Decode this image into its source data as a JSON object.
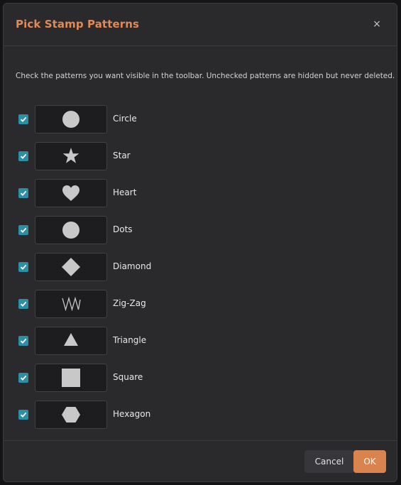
{
  "dialog": {
    "title": "Pick Stamp Patterns",
    "close_glyph": "×",
    "description": "Check the patterns you want visible in the toolbar. Unchecked patterns are hidden but never deleted."
  },
  "patterns": [
    {
      "label": "Circle",
      "icon": "circle-icon",
      "checked": true
    },
    {
      "label": "Star",
      "icon": "star-icon",
      "checked": true
    },
    {
      "label": "Heart",
      "icon": "heart-icon",
      "checked": true
    },
    {
      "label": "Dots",
      "icon": "dots-icon",
      "checked": true
    },
    {
      "label": "Diamond",
      "icon": "diamond-icon",
      "checked": true
    },
    {
      "label": "Zig-Zag",
      "icon": "zigzag-icon",
      "checked": true
    },
    {
      "label": "Triangle",
      "icon": "triangle-icon",
      "checked": true
    },
    {
      "label": "Square",
      "icon": "square-icon",
      "checked": true
    },
    {
      "label": "Hexagon",
      "icon": "hexagon-icon",
      "checked": true
    }
  ],
  "footer": {
    "cancel_label": "Cancel",
    "ok_label": "OK"
  },
  "colors": {
    "accent": "#e08a58",
    "ok_button": "#d9844f",
    "checkbox": "#2b8fa8",
    "dialog_bg": "#2a2a2d",
    "shape_fill": "#c8c8c8"
  }
}
